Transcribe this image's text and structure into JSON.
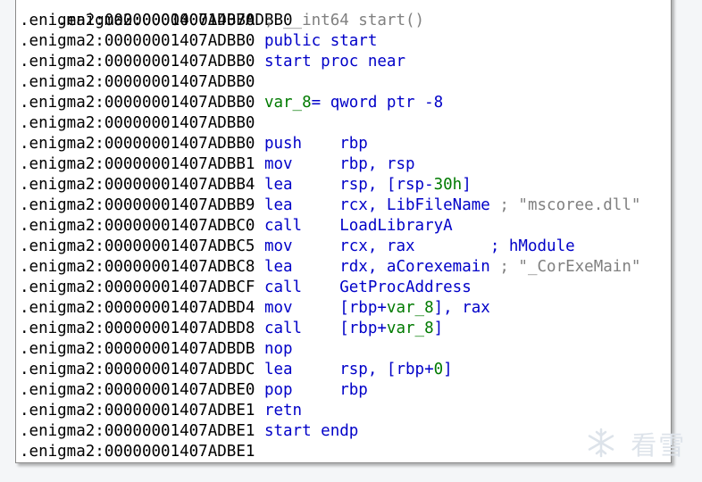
{
  "colors": {
    "keyword": "#0000c8",
    "variable": "#007a00",
    "comment": "#808080",
    "text": "#000000"
  },
  "lines": [
    {
      "addr": ".enigma2:00000001407ADBB0",
      "parts": [
        {
          "c": "comment",
          "t": " ; __int64 start()"
        }
      ]
    },
    {
      "addr": ".enigma2:00000001407ADBB0",
      "parts": [
        {
          "c": "plain",
          "t": " "
        },
        {
          "c": "kw",
          "t": "public start"
        }
      ]
    },
    {
      "addr": ".enigma2:00000001407ADBB0",
      "parts": [
        {
          "c": "plain",
          "t": " "
        },
        {
          "c": "kw",
          "t": "start proc near"
        }
      ]
    },
    {
      "addr": ".enigma2:00000001407ADBB0",
      "parts": []
    },
    {
      "addr": ".enigma2:00000001407ADBB0",
      "parts": [
        {
          "c": "plain",
          "t": " "
        },
        {
          "c": "var",
          "t": "var_8"
        },
        {
          "c": "kw",
          "t": "= qword ptr -8"
        }
      ]
    },
    {
      "addr": ".enigma2:00000001407ADBB0",
      "parts": []
    },
    {
      "addr": ".enigma2:00000001407ADBB0",
      "parts": [
        {
          "c": "plain",
          "t": " "
        },
        {
          "c": "kw",
          "t": "push    rbp"
        }
      ]
    },
    {
      "addr": ".enigma2:00000001407ADBB1",
      "parts": [
        {
          "c": "plain",
          "t": " "
        },
        {
          "c": "kw",
          "t": "mov     rbp, rsp"
        }
      ]
    },
    {
      "addr": ".enigma2:00000001407ADBB4",
      "parts": [
        {
          "c": "plain",
          "t": " "
        },
        {
          "c": "kw",
          "t": "lea     rsp, [rsp-"
        },
        {
          "c": "num",
          "t": "30h"
        },
        {
          "c": "kw",
          "t": "]"
        }
      ]
    },
    {
      "addr": ".enigma2:00000001407ADBB9",
      "parts": [
        {
          "c": "plain",
          "t": " "
        },
        {
          "c": "kw",
          "t": "lea     rcx, LibFileName "
        },
        {
          "c": "comment",
          "t": "; \"mscoree.dll\""
        }
      ]
    },
    {
      "addr": ".enigma2:00000001407ADBC0",
      "parts": [
        {
          "c": "plain",
          "t": " "
        },
        {
          "c": "kw",
          "t": "call    LoadLibraryA"
        }
      ]
    },
    {
      "addr": ".enigma2:00000001407ADBC5",
      "parts": [
        {
          "c": "plain",
          "t": " "
        },
        {
          "c": "kw",
          "t": "mov     rcx, rax        ; hModule"
        }
      ]
    },
    {
      "addr": ".enigma2:00000001407ADBC8",
      "parts": [
        {
          "c": "plain",
          "t": " "
        },
        {
          "c": "kw",
          "t": "lea     rdx, aCorexemain "
        },
        {
          "c": "comment",
          "t": "; \"_CorExeMain\""
        }
      ]
    },
    {
      "addr": ".enigma2:00000001407ADBCF",
      "parts": [
        {
          "c": "plain",
          "t": " "
        },
        {
          "c": "kw",
          "t": "call    GetProcAddress"
        }
      ]
    },
    {
      "addr": ".enigma2:00000001407ADBD4",
      "parts": [
        {
          "c": "plain",
          "t": " "
        },
        {
          "c": "kw",
          "t": "mov     [rbp+"
        },
        {
          "c": "var",
          "t": "var_8"
        },
        {
          "c": "kw",
          "t": "], rax"
        }
      ]
    },
    {
      "addr": ".enigma2:00000001407ADBD8",
      "parts": [
        {
          "c": "plain",
          "t": " "
        },
        {
          "c": "kw",
          "t": "call    [rbp+"
        },
        {
          "c": "var",
          "t": "var_8"
        },
        {
          "c": "kw",
          "t": "]"
        }
      ]
    },
    {
      "addr": ".enigma2:00000001407ADBDB",
      "parts": [
        {
          "c": "plain",
          "t": " "
        },
        {
          "c": "kw",
          "t": "nop"
        }
      ]
    },
    {
      "addr": ".enigma2:00000001407ADBDC",
      "parts": [
        {
          "c": "plain",
          "t": " "
        },
        {
          "c": "kw",
          "t": "lea     rsp, [rbp+"
        },
        {
          "c": "num",
          "t": "0"
        },
        {
          "c": "kw",
          "t": "]"
        }
      ]
    },
    {
      "addr": ".enigma2:00000001407ADBE0",
      "parts": [
        {
          "c": "plain",
          "t": " "
        },
        {
          "c": "kw",
          "t": "pop     rbp"
        }
      ]
    },
    {
      "addr": ".enigma2:00000001407ADBE1",
      "parts": [
        {
          "c": "plain",
          "t": " "
        },
        {
          "c": "kw",
          "t": "retn"
        }
      ]
    },
    {
      "addr": ".enigma2:00000001407ADBE1",
      "parts": [
        {
          "c": "plain",
          "t": " "
        },
        {
          "c": "kw",
          "t": "start endp"
        }
      ]
    },
    {
      "addr": ".enigma2:00000001407ADBE1",
      "parts": []
    }
  ],
  "top_partial_line": {
    "addr": ".enigma2:00000001407ADBB0"
  },
  "watermark": {
    "text": "看雪",
    "icon": "snowflake-icon"
  }
}
